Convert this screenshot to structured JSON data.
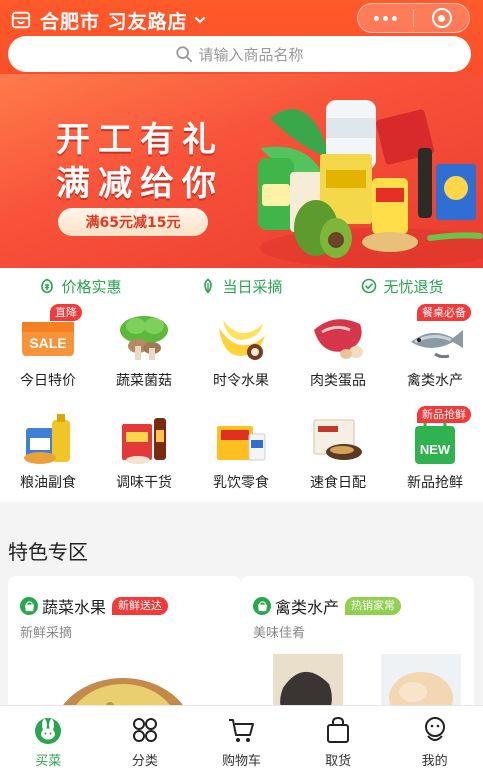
{
  "store": {
    "city": "合肥市",
    "name": "习友路店",
    "display": "合肥市  习友路店"
  },
  "search": {
    "placeholder": "请输入商品名称"
  },
  "banner": {
    "line1": "开工有礼",
    "line2": "满减给你",
    "promo": "满65元减15元"
  },
  "services": [
    {
      "label": "价格实惠",
      "icon": "coin-icon"
    },
    {
      "label": "当日采摘",
      "icon": "leaf-icon"
    },
    {
      "label": "无忧退货",
      "icon": "check-circle-icon"
    }
  ],
  "categories": [
    {
      "label": "今日特价",
      "badge": "直降"
    },
    {
      "label": "蔬菜菌菇",
      "badge": ""
    },
    {
      "label": "时令水果",
      "badge": ""
    },
    {
      "label": "肉类蛋品",
      "badge": ""
    },
    {
      "label": "禽类水产",
      "badge": "餐桌必备"
    },
    {
      "label": "粮油副食",
      "badge": ""
    },
    {
      "label": "调味干货",
      "badge": ""
    },
    {
      "label": "乳饮零食",
      "badge": ""
    },
    {
      "label": "速食日配",
      "badge": ""
    },
    {
      "label": "新品抢鲜",
      "badge": "新品抢鲜"
    }
  ],
  "featured": {
    "title": "特色专区",
    "cards": [
      {
        "title": "蔬菜水果",
        "tag": "新鲜送达",
        "subtitle": "新鲜采摘"
      },
      {
        "title": "禽类水产",
        "tag": "热销家常",
        "subtitle": "美味佳肴"
      }
    ]
  },
  "tabs": [
    {
      "label": "买菜",
      "icon": "rabbit-icon",
      "active": true
    },
    {
      "label": "分类",
      "icon": "grid-icon",
      "active": false
    },
    {
      "label": "购物车",
      "icon": "cart-icon",
      "active": false
    },
    {
      "label": "取货",
      "icon": "bag-icon",
      "active": false
    },
    {
      "label": "我的",
      "icon": "user-icon",
      "active": false
    }
  ],
  "colors": {
    "brand_green": "#2aa44f",
    "banner_red": "#f4442b",
    "badge_red": "#f23a3a",
    "tag_green": "#8fd14f"
  },
  "sale_icon_text": "SALE",
  "new_icon_text": "NEW"
}
